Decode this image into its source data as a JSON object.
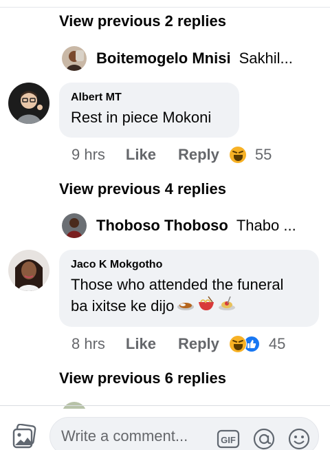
{
  "thread": {
    "view_prev_1": "View previous 2 replies",
    "preview_1": {
      "name": "Boitemogelo Mnisi",
      "snippet": "Sakhil..."
    },
    "comment_1": {
      "author": "Albert MT",
      "text": "Rest in piece Mokoni",
      "time": "9 hrs",
      "like": "Like",
      "reply": "Reply",
      "reaction_count": "55"
    },
    "view_prev_2": "View previous 4 replies",
    "preview_2": {
      "name": "Thoboso Thoboso",
      "snippet": "Thabo ..."
    },
    "comment_2": {
      "author": "Jaco K Mokgotho",
      "text_line1": "Those who attended the funeral",
      "text_line2": "ba ixitse ke dijo",
      "time": "8 hrs",
      "like": "Like",
      "reply": "Reply",
      "reaction_count": "45"
    },
    "view_prev_3": "View previous 6 replies"
  },
  "composer": {
    "placeholder": "Write a comment...",
    "gif_label": "GIF"
  },
  "colors": {
    "bubble": "#f0f2f5",
    "meta": "#65676b",
    "like_blue": "#1877f2",
    "haha_yellow": "#f7b125"
  },
  "icons": {
    "photo": "photo-icon",
    "gif": "gif-icon",
    "mention": "at-icon",
    "emoji": "smiley-icon"
  }
}
